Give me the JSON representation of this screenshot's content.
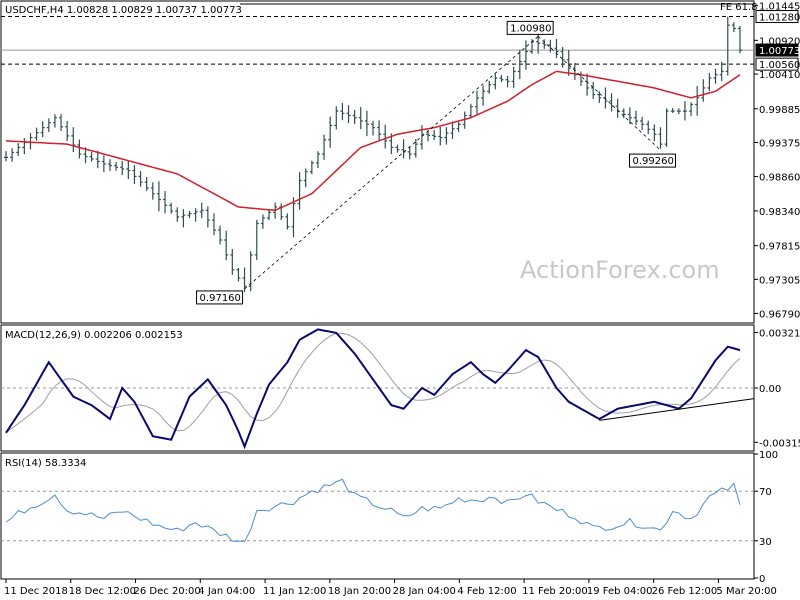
{
  "chart_data": [
    {
      "type": "ohlc",
      "header": "USDCHF,H4  1.00828 1.00829 1.00737 1.00773",
      "ylim": [
        0.9666,
        1.015
      ],
      "y_ticks": [
        "1.01445",
        "1.00920",
        "1.00410",
        "0.99885",
        "0.99375",
        "0.98860",
        "0.98340",
        "0.97815",
        "0.97305",
        "0.96790"
      ],
      "y_tick_values": [
        1.01445,
        1.0092,
        1.0041,
        0.99885,
        0.99375,
        0.9886,
        0.9834,
        0.97815,
        0.97305,
        0.9679
      ],
      "level_labels": [
        {
          "text": "1.01280",
          "value": 1.0128,
          "style": "dashed"
        },
        {
          "text": "1.00773",
          "value": 1.00773,
          "style": "solid"
        },
        {
          "text": "1.00560",
          "value": 1.0056,
          "style": "dashed"
        }
      ],
      "fib_label": "FE 61.8",
      "fib_value": 1.0147,
      "annotations": [
        {
          "text": "1.00980",
          "bar": 87,
          "value": 1.0098
        },
        {
          "text": "0.99260",
          "bar": 107,
          "value": 0.9926
        },
        {
          "text": "0.97160",
          "bar": 39,
          "value": 0.9716
        }
      ],
      "trendlines": [
        {
          "from": {
            "bar": 39,
            "value": 0.9716
          },
          "to": {
            "bar": 87,
            "value": 1.0098
          }
        },
        {
          "from": {
            "bar": 87,
            "value": 1.0098
          },
          "to": {
            "bar": 107,
            "value": 0.9926
          }
        }
      ],
      "close_keypoints": [
        [
          0,
          0.9915
        ],
        [
          4,
          0.9945
        ],
        [
          8,
          0.9975
        ],
        [
          12,
          0.992
        ],
        [
          16,
          0.9905
        ],
        [
          20,
          0.9895
        ],
        [
          24,
          0.986
        ],
        [
          28,
          0.9825
        ],
        [
          32,
          0.9835
        ],
        [
          35,
          0.979
        ],
        [
          37,
          0.9745
        ],
        [
          39,
          0.972
        ],
        [
          41,
          0.9815
        ],
        [
          44,
          0.984
        ],
        [
          46,
          0.981
        ],
        [
          48,
          0.988
        ],
        [
          51,
          0.992
        ],
        [
          54,
          0.9985
        ],
        [
          57,
          0.9975
        ],
        [
          60,
          0.996
        ],
        [
          63,
          0.993
        ],
        [
          66,
          0.992
        ],
        [
          68,
          0.995
        ],
        [
          71,
          0.9945
        ],
        [
          74,
          0.9965
        ],
        [
          77,
          1.0005
        ],
        [
          80,
          1.0035
        ],
        [
          82,
          1.003
        ],
        [
          84,
          1.006
        ],
        [
          86,
          1.009
        ],
        [
          88,
          1.0085
        ],
        [
          90,
          1.0075
        ],
        [
          92,
          1.005
        ],
        [
          94,
          1.003
        ],
        [
          96,
          1.001
        ],
        [
          98,
          1.0
        ],
        [
          100,
          0.9985
        ],
        [
          102,
          0.9975
        ],
        [
          104,
          0.9965
        ],
        [
          106,
          0.995
        ],
        [
          107,
          0.9935
        ],
        [
          108,
          0.9985
        ],
        [
          111,
          0.9985
        ],
        [
          113,
          1.0005
        ],
        [
          115,
          1.0035
        ],
        [
          117,
          1.0045
        ],
        [
          118,
          1.0115
        ],
        [
          119,
          1.011
        ],
        [
          120,
          1.0077
        ]
      ],
      "ma_keypoints": [
        [
          0,
          0.994
        ],
        [
          10,
          0.9935
        ],
        [
          20,
          0.991
        ],
        [
          28,
          0.989
        ],
        [
          32,
          0.987
        ],
        [
          38,
          0.984
        ],
        [
          44,
          0.9835
        ],
        [
          50,
          0.986
        ],
        [
          58,
          0.993
        ],
        [
          64,
          0.995
        ],
        [
          70,
          0.996
        ],
        [
          76,
          0.9975
        ],
        [
          82,
          1.0
        ],
        [
          86,
          1.0025
        ],
        [
          90,
          1.0045
        ],
        [
          94,
          1.004
        ],
        [
          100,
          1.003
        ],
        [
          106,
          1.002
        ],
        [
          112,
          1.0005
        ],
        [
          116,
          1.0015
        ],
        [
          120,
          1.004
        ]
      ]
    },
    {
      "type": "line",
      "label": "MACD(12,26,9) 0.002206 0.002153",
      "ylim": [
        -0.0036,
        0.0036
      ],
      "y_ticks": [
        "0.003219",
        "0.00",
        "-0.003153"
      ],
      "y_tick_values": [
        0.003219,
        0.0,
        -0.003153
      ],
      "zero_line": 0.0,
      "trendline": {
        "from": {
          "bar": 97,
          "value": -0.00188
        },
        "to": {
          "bar": 123,
          "value": -0.00062
        }
      },
      "macd_keypoints": [
        [
          0,
          -0.0026
        ],
        [
          3,
          -0.001
        ],
        [
          7,
          0.0015
        ],
        [
          9,
          0.0005
        ],
        [
          11,
          -0.0005
        ],
        [
          14,
          -0.001
        ],
        [
          17,
          -0.0018
        ],
        [
          19,
          0.0
        ],
        [
          21,
          -0.0008
        ],
        [
          24,
          -0.0028
        ],
        [
          27,
          -0.003
        ],
        [
          30,
          -0.0005
        ],
        [
          33,
          0.0005
        ],
        [
          36,
          -0.001
        ],
        [
          38,
          -0.0025
        ],
        [
          39,
          -0.0034
        ],
        [
          41,
          -0.0015
        ],
        [
          43,
          0.0002
        ],
        [
          46,
          0.0015
        ],
        [
          48,
          0.0028
        ],
        [
          51,
          0.0034
        ],
        [
          54,
          0.0032
        ],
        [
          57,
          0.002
        ],
        [
          60,
          0.0005
        ],
        [
          63,
          -0.001
        ],
        [
          65,
          -0.0012
        ],
        [
          68,
          0.0
        ],
        [
          70,
          -0.0004
        ],
        [
          73,
          0.0008
        ],
        [
          76,
          0.0015
        ],
        [
          78,
          0.0008
        ],
        [
          80,
          0.0003
        ],
        [
          82,
          0.001
        ],
        [
          85,
          0.0022
        ],
        [
          87,
          0.0018
        ],
        [
          90,
          0.0
        ],
        [
          92,
          -0.0008
        ],
        [
          94,
          -0.0012
        ],
        [
          97,
          -0.0018
        ],
        [
          100,
          -0.0012
        ],
        [
          103,
          -0.001
        ],
        [
          106,
          -0.0008
        ],
        [
          108,
          -0.001
        ],
        [
          110,
          -0.0012
        ],
        [
          112,
          -0.0006
        ],
        [
          114,
          0.0005
        ],
        [
          116,
          0.0016
        ],
        [
          118,
          0.0024
        ],
        [
          120,
          0.0022
        ]
      ],
      "signal_lag_bars": 3
    },
    {
      "type": "line",
      "label": "RSI(14) 58.3334",
      "ylim": [
        0,
        100
      ],
      "y_ticks": [
        "100",
        "70",
        "30",
        "0"
      ],
      "y_tick_values": [
        100,
        70,
        30,
        0
      ],
      "dashed_levels": [
        70,
        30
      ],
      "rsi_keypoints": [
        [
          0,
          45
        ],
        [
          3,
          55
        ],
        [
          6,
          62
        ],
        [
          8,
          68
        ],
        [
          10,
          55
        ],
        [
          13,
          52
        ],
        [
          16,
          48
        ],
        [
          19,
          54
        ],
        [
          22,
          48
        ],
        [
          25,
          42
        ],
        [
          28,
          38
        ],
        [
          31,
          45
        ],
        [
          34,
          38
        ],
        [
          37,
          32
        ],
        [
          39,
          28
        ],
        [
          41,
          55
        ],
        [
          44,
          58
        ],
        [
          47,
          62
        ],
        [
          50,
          70
        ],
        [
          53,
          75
        ],
        [
          55,
          78
        ],
        [
          57,
          66
        ],
        [
          60,
          60
        ],
        [
          63,
          54
        ],
        [
          65,
          48
        ],
        [
          68,
          56
        ],
        [
          71,
          56
        ],
        [
          74,
          64
        ],
        [
          77,
          63
        ],
        [
          80,
          66
        ],
        [
          82,
          60
        ],
        [
          85,
          68
        ],
        [
          87,
          62
        ],
        [
          90,
          55
        ],
        [
          93,
          50
        ],
        [
          96,
          40
        ],
        [
          99,
          42
        ],
        [
          102,
          45
        ],
        [
          105,
          42
        ],
        [
          107,
          38
        ],
        [
          109,
          55
        ],
        [
          112,
          48
        ],
        [
          115,
          65
        ],
        [
          117,
          70
        ],
        [
          119,
          74
        ],
        [
          120,
          58
        ]
      ]
    }
  ],
  "time_axis": {
    "labels": [
      "11 Dec 2018",
      "18 Dec 12:00",
      "26 Dec 20:00",
      "4 Jan 04:00",
      "11 Jan 12:00",
      "18 Jan 20:00",
      "28 Jan 04:00",
      "4 Feb 12:00",
      "11 Feb 20:00",
      "19 Feb 04:00",
      "26 Feb 12:00",
      "5 Mar 20:00"
    ],
    "label_bars": [
      0,
      15,
      30,
      45,
      60,
      75,
      90,
      105,
      120,
      135,
      150,
      165
    ]
  },
  "watermark": "ActionForex.com",
  "colors": {
    "bars": "#2f4f4f",
    "ma": "#d0202a",
    "macd": "#0a0a6e",
    "signal": "#a0a0a0",
    "rsi": "#4a8fd0",
    "frame": "#000000",
    "watermark": "#c8c8c8"
  }
}
